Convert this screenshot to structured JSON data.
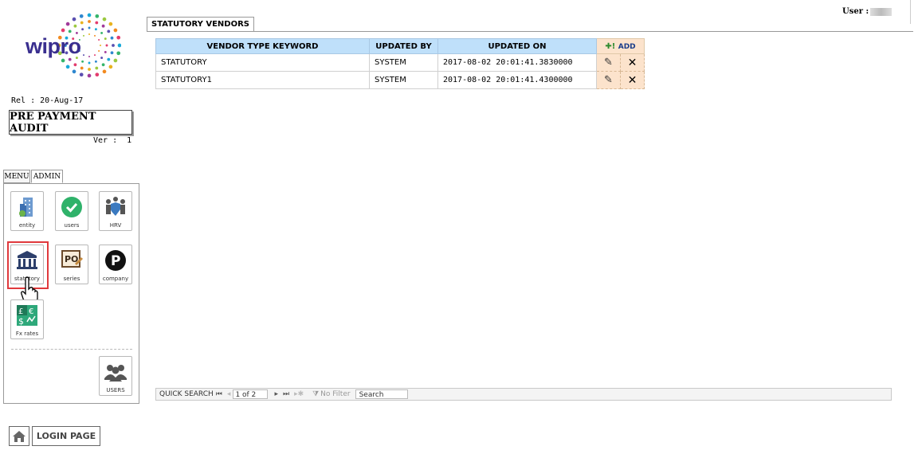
{
  "user": {
    "label": "User :"
  },
  "branding": {
    "logo_text": "wipro",
    "release": "Rel : 20-Aug-17",
    "app_name": "PRE PAYMENT AUDIT",
    "version_label": "Ver :",
    "version_value": "1"
  },
  "tabs": [
    {
      "label": "MENU"
    },
    {
      "label": "ADMIN"
    }
  ],
  "admin_tiles": {
    "entity": "entity",
    "users": "users",
    "hrv": "HRV",
    "statutory": "statutory",
    "series": "series",
    "company": "company",
    "fx_rates": "Fx rates",
    "users_group": "USERS"
  },
  "page_title": "STATUTORY VENDORS",
  "table": {
    "headers": [
      "VENDOR TYPE KEYWORD",
      "UPDATED BY",
      "UPDATED ON"
    ],
    "add_label": "ADD",
    "rows": [
      {
        "keyword": "STATUTORY",
        "updated_by": "SYSTEM",
        "updated_on": "2017-08-02 20:01:41.3830000"
      },
      {
        "keyword": "STATUTORY1",
        "updated_by": "SYSTEM",
        "updated_on": "2017-08-02 20:01:41.4300000"
      }
    ]
  },
  "pager": {
    "quick_search": "QUICK SEARCH",
    "page": "1 of 2",
    "no_filter": "No Filter",
    "search": "Search"
  },
  "login": {
    "label": "LOGIN PAGE"
  },
  "colors": {
    "header_blue": "#bfe0fa",
    "action_peach": "#fce3cc",
    "highlight_red": "#e0393c",
    "wipro_purple": "#3a2f8f"
  }
}
